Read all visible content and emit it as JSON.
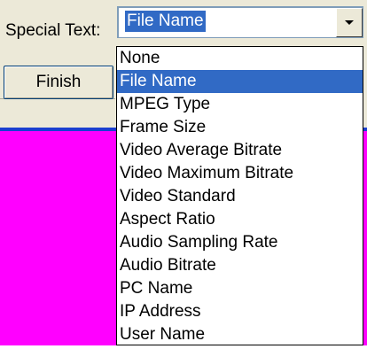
{
  "form": {
    "special_text_label": "Special Text:",
    "finish_label": "Finish"
  },
  "combo": {
    "selected_value": "File Name",
    "button_icon": "chevron-down-icon"
  },
  "dropdown": {
    "options": [
      "None",
      "File Name",
      "MPEG Type",
      "Frame Size",
      "Video Average Bitrate",
      "Video Maximum Bitrate",
      "Video Standard",
      "Aspect Ratio",
      "Audio Sampling Rate",
      "Audio Bitrate",
      "PC Name",
      "IP Address",
      "User Name"
    ],
    "highlighted": "File Name"
  },
  "colors": {
    "form_background": "#ece9d8",
    "selection": "#316ac5",
    "preview_area": "#ff00ff",
    "preview_border": "#1a3fd0"
  }
}
